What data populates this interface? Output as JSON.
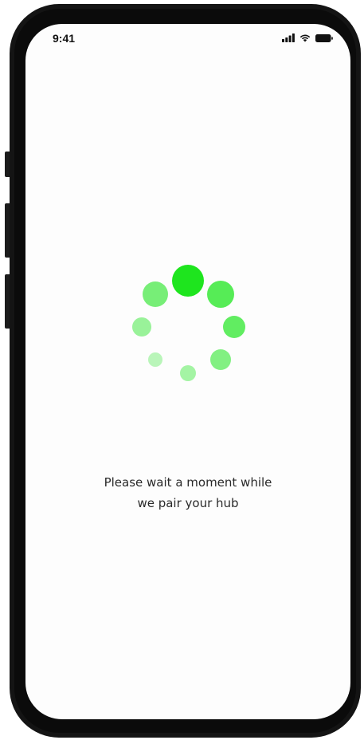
{
  "status_bar": {
    "time": "9:41",
    "icons": [
      "signal-icon",
      "wifi-icon",
      "battery-icon"
    ]
  },
  "loader": {
    "accent_color": "#1ee51e",
    "dot_count": 8,
    "opacities": [
      1.0,
      0.75,
      0.7,
      0.55,
      0.4,
      0.3,
      0.45,
      0.6
    ]
  },
  "message": {
    "line1": "Please wait a moment while",
    "line2": "we pair your hub"
  }
}
